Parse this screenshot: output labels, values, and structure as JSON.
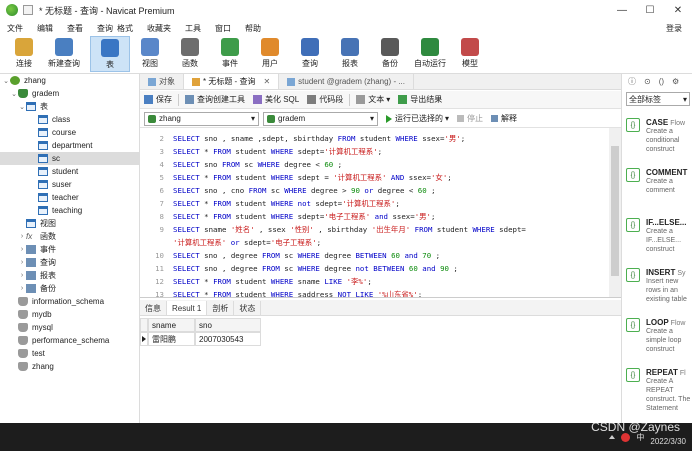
{
  "window": {
    "title": "* 无标题 - 查询 - Navicat Premium",
    "min": "—",
    "max": "☐",
    "close": "✕"
  },
  "menu": {
    "items": [
      "文件",
      "编辑",
      "查看",
      "查询",
      "格式",
      "收藏夹",
      "工具",
      "窗口",
      "帮助"
    ],
    "login": "登录"
  },
  "toolbar": {
    "items": [
      {
        "label": "连接",
        "icon": "plug-icon",
        "color": "#d9a53a"
      },
      {
        "label": "新建查询",
        "icon": "new-query-icon",
        "color": "#4a7fc1"
      },
      {
        "label": "表",
        "icon": "table-icon",
        "color": "#3a76c4",
        "active": true
      },
      {
        "label": "视图",
        "icon": "view-icon",
        "color": "#5a87c9"
      },
      {
        "label": "函数",
        "icon": "function-icon",
        "color": "#6d6d6d"
      },
      {
        "label": "事件",
        "icon": "clock-icon",
        "color": "#3e9c4a"
      },
      {
        "label": "用户",
        "icon": "user-icon",
        "color": "#e08a2c"
      },
      {
        "label": "查询",
        "icon": "query-icon",
        "color": "#3f6eb8"
      },
      {
        "label": "报表",
        "icon": "report-icon",
        "color": "#4773b5"
      },
      {
        "label": "备份",
        "icon": "backup-icon",
        "color": "#5a5a5a"
      },
      {
        "label": "自动运行",
        "icon": "autorun-icon",
        "color": "#2f8a3f"
      },
      {
        "label": "模型",
        "icon": "model-icon",
        "color": "#c24a4a"
      }
    ]
  },
  "tree": {
    "connection": "zhang",
    "db": "gradem",
    "tables_folder": "表",
    "tables": [
      "class",
      "course",
      "department",
      "sc",
      "student",
      "suser",
      "teacher",
      "teaching"
    ],
    "selected_table": "sc",
    "folders": [
      "视图",
      "函数",
      "事件",
      "查询",
      "报表",
      "备份"
    ],
    "other_dbs": [
      "information_schema",
      "mydb",
      "mysql",
      "performance_schema",
      "test",
      "zhang"
    ]
  },
  "tabs": [
    {
      "label": "对象"
    },
    {
      "label": "* 无标题 - 查询",
      "active": true
    },
    {
      "label": "student @gradem (zhang) - ..."
    }
  ],
  "qtoolbar": [
    "保存",
    "查询创建工具",
    "美化 SQL",
    "代码段",
    "文本",
    "导出结果"
  ],
  "qselect": {
    "connection": "zhang",
    "database": "gradem",
    "run_selected": "运行已选择的",
    "stop": "停止",
    "explain": "解释"
  },
  "editor": {
    "lines": [
      {
        "n": "2",
        "html": "<span class='kw'>SELECT</span> sno , sname ,sdept, sbirthday <span class='kw'>FROM</span> student <span class='kw'>WHERE</span> ssex=<span class='str'>'男'</span>;"
      },
      {
        "n": "3",
        "html": "<span class='kw'>SELECT</span> * <span class='kw'>FROM</span> student <span class='kw'>WHERE</span> sdept=<span class='str'>'计算机工程系'</span>;"
      },
      {
        "n": "4",
        "html": "<span class='kw'>SELECT</span> sno <span class='kw'>FROM</span> sc <span class='kw'>WHERE</span> degree &lt; <span class='num'>60</span> ;"
      },
      {
        "n": "5",
        "html": "<span class='kw'>SELECT</span> * <span class='kw'>FROM</span> student <span class='kw'>WHERE</span> sdept = <span class='str'>'计算机工程系'</span> <span class='kw'>AND</span> ssex=<span class='str'>'女'</span>;"
      },
      {
        "n": "6",
        "html": "<span class='kw'>SELECT</span> sno , cno <span class='kw'>FROM</span> sc <span class='kw'>WHERE</span> degree &gt; <span class='num'>90</span> <span class='kw'>or</span> degree &lt; <span class='num'>60</span> ;"
      },
      {
        "n": "7",
        "html": "<span class='kw'>SELECT</span> * <span class='kw'>FROM</span> student <span class='kw'>WHERE</span> <span class='kw'>not</span> sdept=<span class='str'>'计算机工程系'</span>;"
      },
      {
        "n": "8",
        "html": "<span class='kw'>SELECT</span> * <span class='kw'>FROM</span> student <span class='kw'>WHERE</span> sdept=<span class='str'>'电子工程系'</span> <span class='kw'>and</span> ssex=<span class='str'>'男'</span>;"
      },
      {
        "n": "9",
        "html": "<span class='kw'>SELECT</span> sname <span class='str'>'姓名'</span> , ssex <span class='str'>'性别'</span> , sbirthday <span class='str'>'出生年月'</span> <span class='kw'>FROM</span> student <span class='kw'>WHERE</span>  sdept="
      },
      {
        "n": "",
        "html": "<span class='str'>'计算机工程系'</span> <span class='kw'>or</span> sdept=<span class='str'>'电子工程系'</span>;"
      },
      {
        "n": "10",
        "html": "<span class='kw'>SELECT</span> sno , degree <span class='kw'>FROM</span> sc <span class='kw'>WHERE</span>  degree  <span class='kw'>BETWEEN</span> <span class='num'>60</span> <span class='kw'>and</span> <span class='num'>70</span> ;"
      },
      {
        "n": "11",
        "html": "<span class='kw'>SELECT</span> sno , degree <span class='kw'>FROM</span> sc <span class='kw'>WHERE</span>  degree <span class='kw'>not BETWEEN</span> <span class='num'>60</span> <span class='kw'>and</span> <span class='num'>90</span> ;"
      },
      {
        "n": "12",
        "html": "<span class='kw'>SELECT</span> * <span class='kw'>FROM</span> student <span class='kw'>WHERE</span> sname  <span class='kw'>LIKE</span> <span class='str'>'李%'</span>;"
      },
      {
        "n": "13",
        "html": "<span class='kw'>SELECT</span> * <span class='kw'>FROM</span> student <span class='kw'>WHERE</span> saddress <span class='kw'>NOT LIKE</span> <span class='str'>'%山东省%'</span>;"
      },
      {
        "n": "14",
        "html": "<span class='kw'>SELECT</span> sname , sno  <span class='kw'>FROM</span> student <span class='kw'>WHERE</span> sname  <span class='kw'>LIKE</span> <span class='str'>'_阳%'</span>;",
        "highlight": true
      },
      {
        "n": "15",
        "html": ""
      }
    ]
  },
  "result_tabs": [
    {
      "label": "信息"
    },
    {
      "label": "Result 1",
      "active": true
    },
    {
      "label": "剖析"
    },
    {
      "label": "状态"
    }
  ],
  "result": {
    "columns": [
      "sname",
      "sno"
    ],
    "rows": [
      [
        "雷阳鹏",
        "2007030543"
      ]
    ]
  },
  "right_panel": {
    "filter": "全部标签",
    "snippets": [
      {
        "title": "CASE",
        "suffix": "Flow",
        "desc": "Create a conditional construct"
      },
      {
        "title": "COMMENT",
        "suffix": "",
        "desc": "Create a comment"
      },
      {
        "title": "IF...ELSE...",
        "suffix": "",
        "desc": "Create a IF...ELSE... construct"
      },
      {
        "title": "INSERT",
        "suffix": "Sy",
        "desc": "Insert new rows in an existing table"
      },
      {
        "title": "LOOP",
        "suffix": "Flow",
        "desc": "Create a simple loop construct"
      },
      {
        "title": "REPEAT",
        "suffix": "Fl",
        "desc": "Create A REPEAT construct. The Statement"
      }
    ]
  },
  "taskbar": {
    "date": "2022/3/30",
    "watermark": "CSDN @Zaynes"
  }
}
